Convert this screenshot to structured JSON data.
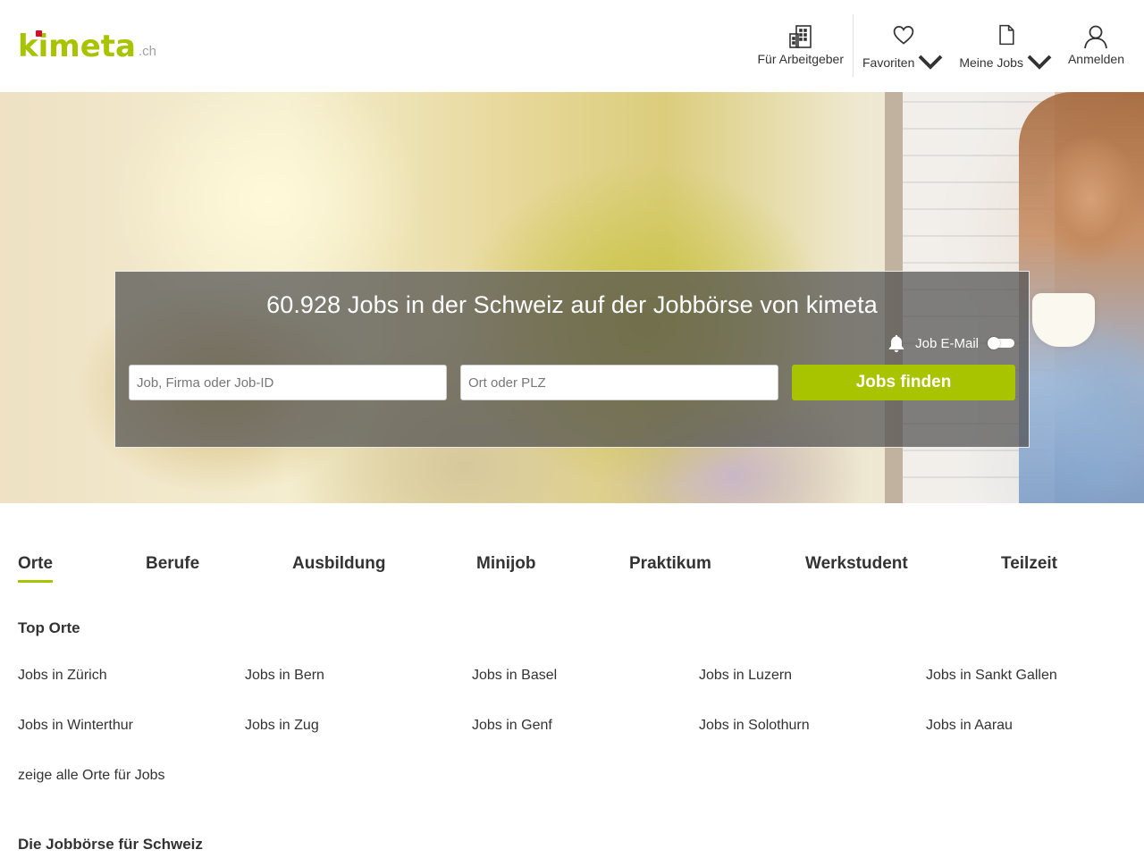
{
  "brand": {
    "name": "kimeta",
    "tld": ".ch",
    "colors": {
      "accent": "#a8c400",
      "dot": "#d40f2c",
      "text": "#333333"
    }
  },
  "nav": {
    "employer": {
      "label": "Für Arbeitgeber",
      "icon": "building-icon"
    },
    "favorites": {
      "label": "Favoriten",
      "icon": "heart-icon"
    },
    "my_jobs": {
      "label": "Meine Jobs",
      "icon": "document-icon"
    },
    "login": {
      "label": "Anmelden",
      "icon": "user-icon"
    }
  },
  "hero": {
    "title": "60.928 Jobs in der Schweiz auf der Jobbörse von kimeta",
    "job_email_label": "Job E-Mail",
    "job_email_enabled": false,
    "job_input_placeholder": "Job, Firma oder Job-ID",
    "location_input_placeholder": "Ort oder PLZ",
    "search_button": "Jobs finden"
  },
  "tabs": [
    {
      "label": "Orte",
      "active": true
    },
    {
      "label": "Berufe",
      "active": false
    },
    {
      "label": "Ausbildung",
      "active": false
    },
    {
      "label": "Minijob",
      "active": false
    },
    {
      "label": "Praktikum",
      "active": false
    },
    {
      "label": "Werkstudent",
      "active": false
    },
    {
      "label": "Teilzeit",
      "active": false
    }
  ],
  "top_places": {
    "title": "Top Orte",
    "links": [
      "Jobs in Zürich",
      "Jobs in Bern",
      "Jobs in Basel",
      "Jobs in Luzern",
      "Jobs in Sankt Gallen",
      "Jobs in Winterthur",
      "Jobs in Zug",
      "Jobs in Genf",
      "Jobs in Solothurn",
      "Jobs in Aarau"
    ],
    "show_all": "zeige alle Orte für Jobs"
  },
  "footer_section_title": "Die Jobbörse für Schweiz"
}
